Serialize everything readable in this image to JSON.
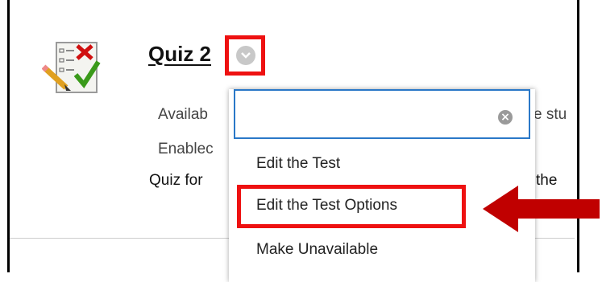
{
  "item": {
    "title": "Quiz 2",
    "line1_left": "Availab",
    "line1_right": "e stu",
    "line2_left": "Enablec",
    "line3_left": "Quiz for",
    "line3_right": "the"
  },
  "icons": {
    "quiz": "test-clipboard-icon",
    "chevron": "chevron-down-icon",
    "clear": "clear-icon",
    "arrow": "red-arrow-left-icon"
  },
  "dropdown": {
    "search_value": "",
    "clear_glyph": "×",
    "items": [
      {
        "label": "Edit the Test"
      },
      {
        "label": "Edit the Test Options"
      },
      {
        "label": "Make Unavailable"
      }
    ]
  },
  "colors": {
    "highlight": "#ee1111",
    "arrow": "#c00000",
    "focus_border": "#2a78c8"
  }
}
